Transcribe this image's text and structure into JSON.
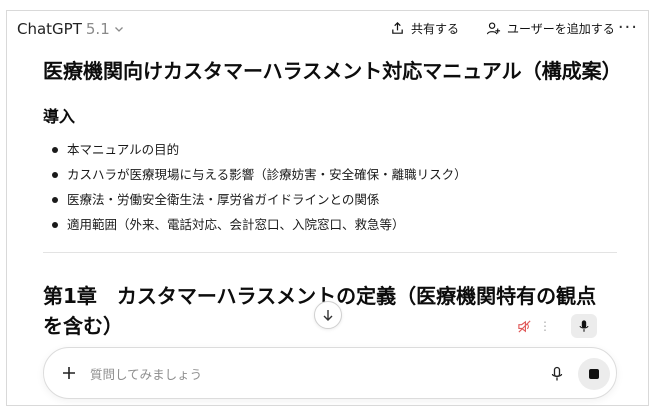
{
  "header": {
    "model_name": "ChatGPT",
    "model_version": "5.1",
    "share_label": "共有する",
    "add_user_label": "ユーザーを追加する",
    "more_label": "···"
  },
  "document": {
    "title": "医療機関向けカスタマーハラスメント対応マニュアル（構成案）",
    "intro_heading": "導入",
    "intro_items": [
      "本マニュアルの目的",
      "カスハラが医療現場に与える影響（診療妨害・安全確保・離職リスク）",
      "医療法・労働安全衛生法・厚労省ガイドラインとの関係",
      "適用範囲（外来、電話対応、会計窓口、入院窓口、救急等）"
    ],
    "chapter_heading": "第1章　カスタマーハラスメントの定義（医療機関特有の観点を含む）"
  },
  "composer": {
    "placeholder": "質問してみましょう",
    "value": ""
  },
  "icons": {
    "model_chevron": "chevron-down-icon",
    "share": "share-icon",
    "add_user": "add-user-icon",
    "more": "more-icon",
    "scroll_down": "arrow-down-icon",
    "voice_mute": "speaker-muted-icon",
    "voice_mic": "microphone-icon",
    "plus": "plus-icon",
    "mic": "microphone-icon",
    "stop": "stop-icon"
  },
  "colors": {
    "text": "#0d0d0d",
    "muted": "#8a8a8a",
    "border": "#d9d9d9",
    "mute_red": "#e05a5a"
  }
}
